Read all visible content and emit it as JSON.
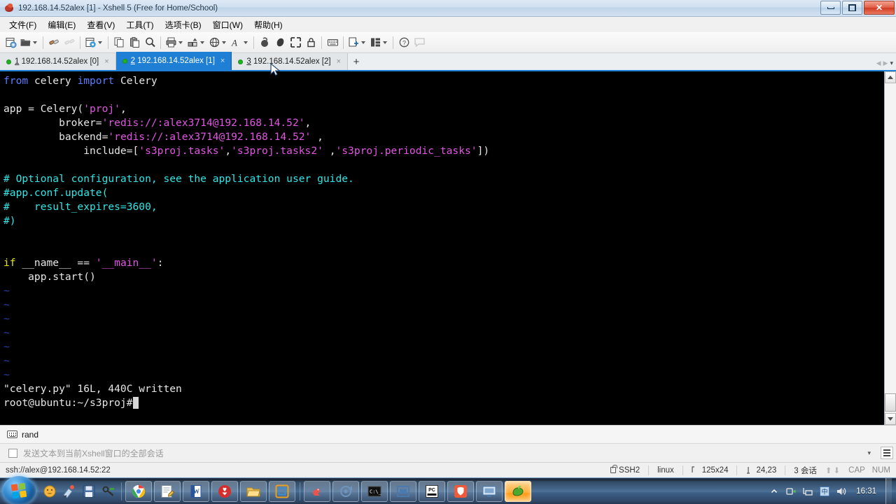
{
  "window": {
    "title": "192.168.14.52alex [1] - Xshell 5 (Free for Home/School)",
    "app_icon": "xshell-icon",
    "minimize_label": "Minimize",
    "restore_label": "Restore",
    "close_label": "Close"
  },
  "menubar": {
    "items": [
      {
        "label": "文件(F)",
        "name": "menu-file"
      },
      {
        "label": "编辑(E)",
        "name": "menu-edit"
      },
      {
        "label": "查看(V)",
        "name": "menu-view"
      },
      {
        "label": "工具(T)",
        "name": "menu-tools"
      },
      {
        "label": "选项卡(B)",
        "name": "menu-tabs"
      },
      {
        "label": "窗口(W)",
        "name": "menu-window"
      },
      {
        "label": "帮助(H)",
        "name": "menu-help"
      }
    ]
  },
  "toolbar": {
    "buttons": [
      {
        "icon": "new-session-icon",
        "has_caret": false
      },
      {
        "icon": "open-folder-icon",
        "has_caret": true
      },
      {
        "sep": true
      },
      {
        "icon": "connect-icon",
        "has_caret": false
      },
      {
        "icon": "disconnect-icon",
        "has_caret": false
      },
      {
        "sep": true
      },
      {
        "icon": "properties-gear-icon",
        "has_caret": true
      },
      {
        "sep": true
      },
      {
        "icon": "copy-icon",
        "has_caret": false
      },
      {
        "icon": "paste-icon",
        "has_caret": false
      },
      {
        "icon": "find-icon",
        "has_caret": false
      },
      {
        "sep": true
      },
      {
        "icon": "print-icon",
        "has_caret": true
      },
      {
        "icon": "transfer-file-icon",
        "has_caret": true
      },
      {
        "icon": "globe-icon",
        "has_caret": true
      },
      {
        "icon": "font-icon",
        "has_caret": true
      },
      {
        "sep": true
      },
      {
        "icon": "log-icon",
        "has_caret": false
      },
      {
        "icon": "highlight-icon",
        "has_caret": false
      },
      {
        "icon": "fullscreen-icon",
        "has_caret": false
      },
      {
        "icon": "lock-icon",
        "has_caret": false
      },
      {
        "sep": true
      },
      {
        "icon": "keyboard-icon",
        "has_caret": false
      },
      {
        "sep": true
      },
      {
        "icon": "add-pane-icon",
        "has_caret": true
      },
      {
        "icon": "layout-icon",
        "has_caret": true
      },
      {
        "sep": true
      },
      {
        "icon": "help-icon",
        "has_caret": false
      },
      {
        "icon": "chat-icon",
        "has_caret": false
      }
    ]
  },
  "tabs": {
    "items": [
      {
        "num": "1",
        "label": "192.168.14.52alex [0]",
        "active": false,
        "status_color": "#22b123"
      },
      {
        "num": "2",
        "label": "192.168.14.52alex [1]",
        "active": true,
        "status_color": "#22b123"
      },
      {
        "num": "3",
        "label": "192.168.14.52alex [2]",
        "active": false,
        "status_color": "#22b123"
      }
    ],
    "add_label": "+",
    "close_glyph": "×",
    "nav_prev": "◀",
    "nav_next": "▶",
    "nav_menu": "▾"
  },
  "terminal": {
    "lines": [
      [
        {
          "t": "from ",
          "c": "kw"
        },
        {
          "t": "celery ",
          "c": "plain"
        },
        {
          "t": "import ",
          "c": "kw"
        },
        {
          "t": "Celery",
          "c": "plain"
        }
      ],
      [
        {
          "t": "",
          "c": "plain"
        }
      ],
      [
        {
          "t": "app = Celery(",
          "c": "plain"
        },
        {
          "t": "'proj'",
          "c": "str"
        },
        {
          "t": ",",
          "c": "plain"
        }
      ],
      [
        {
          "t": "         broker=",
          "c": "plain"
        },
        {
          "t": "'redis://:alex3714@192.168.14.52'",
          "c": "str"
        },
        {
          "t": ",",
          "c": "plain"
        }
      ],
      [
        {
          "t": "         backend=",
          "c": "plain"
        },
        {
          "t": "'redis://:alex3714@192.168.14.52'",
          "c": "str"
        },
        {
          "t": " ,",
          "c": "plain"
        }
      ],
      [
        {
          "t": "             include=[",
          "c": "plain"
        },
        {
          "t": "'s3proj.tasks'",
          "c": "str"
        },
        {
          "t": ",",
          "c": "plain"
        },
        {
          "t": "'s3proj.tasks2'",
          "c": "str"
        },
        {
          "t": " ,",
          "c": "plain"
        },
        {
          "t": "'s3proj.periodic_tasks'",
          "c": "str"
        },
        {
          "t": "])",
          "c": "plain"
        }
      ],
      [
        {
          "t": "",
          "c": "plain"
        }
      ],
      [
        {
          "t": "# Optional configuration, see the application user guide.",
          "c": "cmt"
        }
      ],
      [
        {
          "t": "#app.conf.update(",
          "c": "cmt"
        }
      ],
      [
        {
          "t": "#    result_expires=3600,",
          "c": "cmt"
        }
      ],
      [
        {
          "t": "#)",
          "c": "cmt"
        }
      ],
      [
        {
          "t": "",
          "c": "plain"
        }
      ],
      [
        {
          "t": "",
          "c": "plain"
        }
      ],
      [
        {
          "t": "if ",
          "c": "cond"
        },
        {
          "t": "__name__ == ",
          "c": "plain"
        },
        {
          "t": "'__main__'",
          "c": "str"
        },
        {
          "t": ":",
          "c": "plain"
        }
      ],
      [
        {
          "t": "    app.start()",
          "c": "plain"
        }
      ],
      [
        {
          "t": "~",
          "c": "tilde"
        }
      ],
      [
        {
          "t": "~",
          "c": "tilde"
        }
      ],
      [
        {
          "t": "~",
          "c": "tilde"
        }
      ],
      [
        {
          "t": "~",
          "c": "tilde"
        }
      ],
      [
        {
          "t": "~",
          "c": "tilde"
        }
      ],
      [
        {
          "t": "~",
          "c": "tilde"
        }
      ],
      [
        {
          "t": "~",
          "c": "tilde"
        }
      ],
      [
        {
          "t": "\"celery.py\" 16L, 440C written",
          "c": "plain"
        }
      ],
      [
        {
          "t": "root@ubuntu:~/s3proj#",
          "c": "plain"
        }
      ]
    ]
  },
  "quickbar": {
    "icon": "keyboard-icon",
    "label": "rand"
  },
  "sendbar": {
    "checkbox_checked": false,
    "placeholder": "发送文本到当前Xshell窗口的全部会话",
    "value": "",
    "dropdown_glyph": "▾",
    "list_button": "history-list-icon"
  },
  "statusbar": {
    "connection": "ssh://alex@192.168.14.52:22",
    "protocol": "SSH2",
    "term_type": "linux",
    "size": "125x24",
    "cursor_pos": "24,23",
    "sessions": "3 会话",
    "cap": "CAP",
    "num": "NUM",
    "size_icon": "terminal-size-icon",
    "pos_icon": "cursor-pos-icon",
    "lock_icon": "lock-icon"
  },
  "taskbar": {
    "start_label": "Start",
    "quicklaunch": [
      {
        "name": "media-player-icon",
        "color": "#f2b134"
      },
      {
        "name": "paint-icon",
        "color": "#c0d8f0"
      },
      {
        "name": "save-icon",
        "color": "#4a6fa5"
      },
      {
        "name": "keys-icon",
        "color": "#5c5c5c"
      }
    ],
    "items": [
      {
        "name": "taskbar-item-chrome",
        "icon": "chrome-icon",
        "active": false
      },
      {
        "name": "taskbar-item-notepad",
        "icon": "notepad-icon",
        "active": false
      },
      {
        "name": "taskbar-item-word",
        "icon": "word-icon",
        "active": false
      },
      {
        "name": "taskbar-item-antivirus",
        "icon": "shield-icon",
        "active": false
      },
      {
        "name": "taskbar-item-explorer",
        "icon": "folder-icon",
        "active": false
      },
      {
        "name": "taskbar-item-vm",
        "icon": "vmware-icon",
        "active": false
      },
      {
        "name": "taskbar-item-duck",
        "icon": "duck-icon",
        "active": false
      },
      {
        "name": "taskbar-item-recorder",
        "icon": "recorder-icon",
        "active": false
      },
      {
        "name": "taskbar-item-cmd",
        "icon": "cmd-icon",
        "active": false
      },
      {
        "name": "taskbar-item-window",
        "icon": "window-icon",
        "active": false
      },
      {
        "name": "taskbar-item-pycharm",
        "icon": "pycharm-icon",
        "active": false
      },
      {
        "name": "taskbar-item-security",
        "icon": "security-icon",
        "active": false
      },
      {
        "name": "taskbar-item-remote",
        "icon": "remote-desktop-icon",
        "active": false
      },
      {
        "name": "taskbar-item-xshell",
        "icon": "xshell-icon",
        "active": true
      }
    ],
    "tray": [
      {
        "name": "tray-hidden-icon",
        "glyph": "▲"
      },
      {
        "name": "tray-safely-remove-icon",
        "glyph": "⏏"
      },
      {
        "name": "tray-network-icon",
        "glyph": "🖧"
      },
      {
        "name": "tray-input-method-icon",
        "glyph": "中"
      },
      {
        "name": "tray-volume-icon",
        "glyph": "🔊"
      }
    ],
    "clock": "16:31"
  }
}
